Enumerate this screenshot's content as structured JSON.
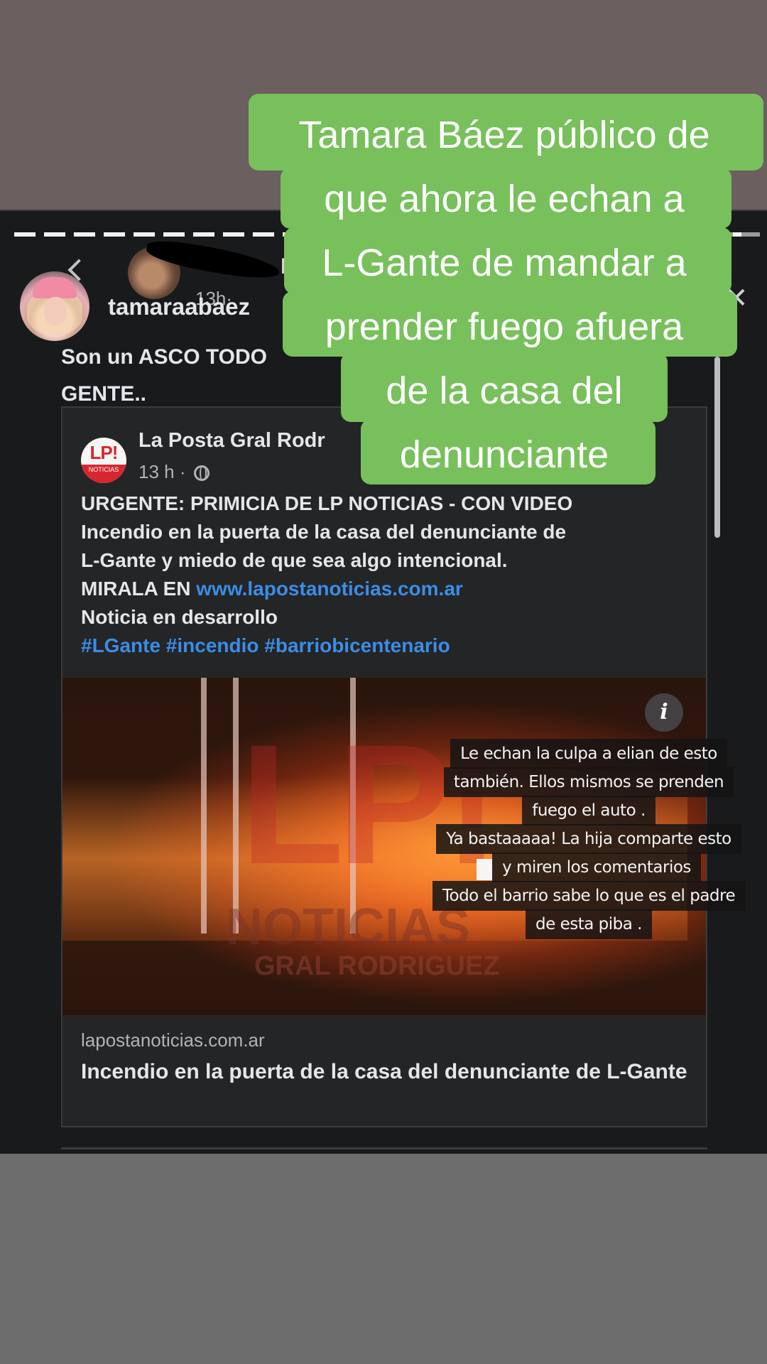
{
  "caption": {
    "lines": [
      "Tamara Báez público de",
      "que ahora le echan a",
      "L-Gante de mandar a",
      "prender fuego afuera",
      "de la casa del",
      "denunciante"
    ],
    "box_color": "#78c05b",
    "text_color": "#ffffff"
  },
  "story": {
    "username": "tamaraabaez",
    "post_text": "Son un ASCO TODO GENTE..",
    "second_user_name": "la",
    "second_user_meta": "13h·"
  },
  "shared_post": {
    "source_name": "La Posta Gral Rodr",
    "meta": "13 h ·",
    "logo_text": "LP!",
    "logo_sub": "NOTICIAS",
    "line1": "URGENTE: PRIMICIA DE LP NOTICIAS - CON VIDEO",
    "line2": "Incendio en la puerta de la casa del denunciante de",
    "line3": "L-Gante y miedo de que sea algo intencional.",
    "line4_prefix": "MIRALA EN ",
    "line4_link": "www.lapostanoticias.com.ar",
    "line5": "Noticia en desarrollo",
    "hashtags": "#LGante #incendio #barriobicentenario",
    "link_color": "#3b8de8"
  },
  "image": {
    "watermark_main": "LP!",
    "watermark_sub": "NOTICIAS",
    "watermark_sub2": "GRAL RODRIGUEZ",
    "info_icon": "i"
  },
  "overlay_text": {
    "line1": "Le echan la culpa a elian de esto",
    "line2": "también. Ellos mismos se prenden",
    "line3": "fuego el auto .",
    "line4": "Ya bastaaaaa!  La hija comparte esto",
    "line5": "y miren los comentarios",
    "line6": "Todo el barrio sabe lo que es el padre",
    "line7": "de esta piba ."
  },
  "link_preview": {
    "domain": "lapostanoticias.com.ar",
    "headline": "Incendio en la puerta de la casa del denunciante de L-Gante"
  }
}
